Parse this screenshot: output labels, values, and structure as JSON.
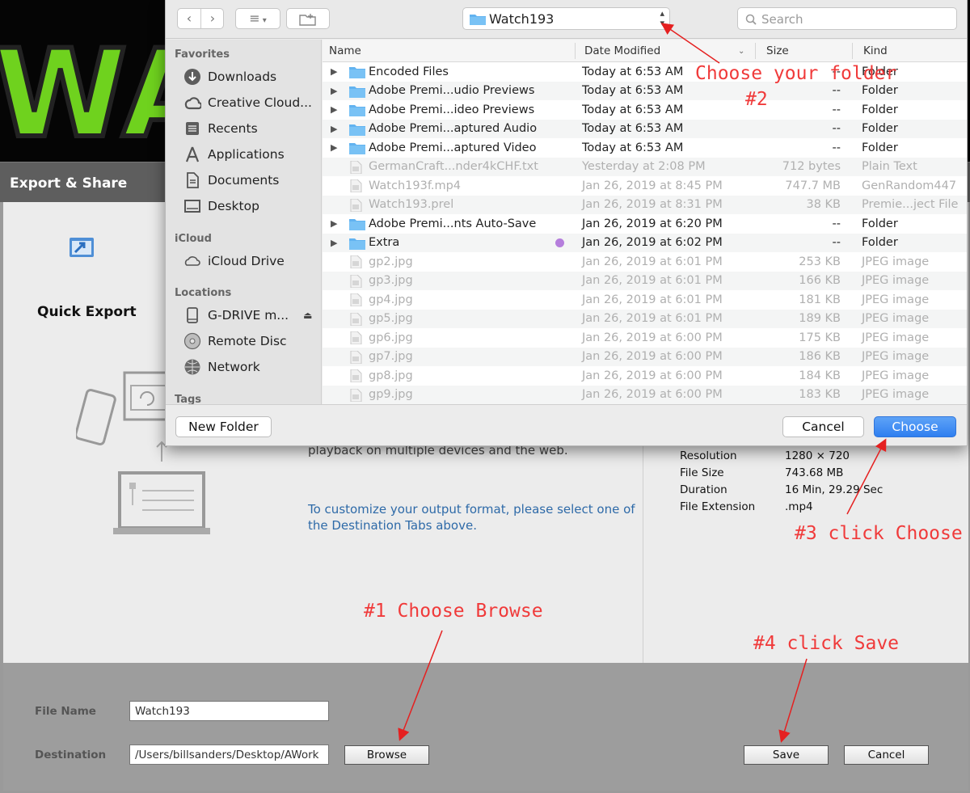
{
  "app": {
    "logo_text": "WA",
    "header_title": "Export & Share",
    "quick_export_label": "Quick Export",
    "description": "playback on multiple devices and the web.",
    "customize_text": "To customize your output format, please select one of the Destination Tabs above.",
    "info": [
      {
        "key": "Resolution",
        "value": "1280 × 720"
      },
      {
        "key": "File Size",
        "value": "743.68 MB"
      },
      {
        "key": "Duration",
        "value": "16 Min, 29.29 Sec"
      },
      {
        "key": "File Extension",
        "value": ".mp4"
      }
    ],
    "file_name_label": "File Name",
    "file_name_value": "Watch193",
    "destination_label": "Destination",
    "destination_value": "/Users/billsanders/Desktop/AWork",
    "browse_label": "Browse",
    "save_label": "Save",
    "cancel_label": "Cancel"
  },
  "dialog": {
    "current_folder": "Watch193",
    "search_placeholder": "Search",
    "sidebar": {
      "favorites_heading": "Favorites",
      "favorites": [
        {
          "label": "Downloads",
          "icon": "downloads-icon"
        },
        {
          "label": "Creative Cloud...",
          "icon": "creative-cloud-icon"
        },
        {
          "label": "Recents",
          "icon": "recents-icon"
        },
        {
          "label": "Applications",
          "icon": "applications-icon"
        },
        {
          "label": "Documents",
          "icon": "documents-icon"
        },
        {
          "label": "Desktop",
          "icon": "desktop-icon"
        }
      ],
      "icloud_heading": "iCloud",
      "icloud": [
        {
          "label": "iCloud Drive",
          "icon": "cloud-icon"
        }
      ],
      "locations_heading": "Locations",
      "locations": [
        {
          "label": "G-DRIVE m...",
          "icon": "drive-icon"
        },
        {
          "label": "Remote Disc",
          "icon": "disc-icon"
        },
        {
          "label": "Network",
          "icon": "globe-icon"
        }
      ],
      "tags_heading": "Tags"
    },
    "columns": {
      "name": "Name",
      "date": "Date Modified",
      "size": "Size",
      "kind": "Kind"
    },
    "files": [
      {
        "name": "Encoded Files",
        "date": "Today at 6:53 AM",
        "size": "--",
        "kind": "Folder",
        "folder": true
      },
      {
        "name": "Adobe Premi...udio Previews",
        "date": "Today at 6:53 AM",
        "size": "--",
        "kind": "Folder",
        "folder": true
      },
      {
        "name": "Adobe Premi...ideo Previews",
        "date": "Today at 6:53 AM",
        "size": "--",
        "kind": "Folder",
        "folder": true
      },
      {
        "name": "Adobe Premi...aptured Audio",
        "date": "Today at 6:53 AM",
        "size": "--",
        "kind": "Folder",
        "folder": true
      },
      {
        "name": "Adobe Premi...aptured Video",
        "date": "Today at 6:53 AM",
        "size": "--",
        "kind": "Folder",
        "folder": true
      },
      {
        "name": "GermanCraft...nder4kCHF.txt",
        "date": "Yesterday at 2:08 PM",
        "size": "712 bytes",
        "kind": "Plain Text",
        "folder": false
      },
      {
        "name": "Watch193f.mp4",
        "date": "Jan 26, 2019 at 8:45 PM",
        "size": "747.7 MB",
        "kind": "GenRandom447",
        "folder": false
      },
      {
        "name": "Watch193.prel",
        "date": "Jan 26, 2019 at 8:31 PM",
        "size": "38 KB",
        "kind": "Premie...ject File",
        "folder": false
      },
      {
        "name": "Adobe Premi...nts Auto-Save",
        "date": "Jan 26, 2019 at 6:20 PM",
        "size": "--",
        "kind": "Folder",
        "folder": true
      },
      {
        "name": "Extra",
        "date": "Jan 26, 2019 at 6:02 PM",
        "size": "--",
        "kind": "Folder",
        "folder": true
      },
      {
        "name": "gp2.jpg",
        "date": "Jan 26, 2019 at 6:01 PM",
        "size": "253 KB",
        "kind": "JPEG image",
        "folder": false
      },
      {
        "name": "gp3.jpg",
        "date": "Jan 26, 2019 at 6:01 PM",
        "size": "166 KB",
        "kind": "JPEG image",
        "folder": false
      },
      {
        "name": "gp4.jpg",
        "date": "Jan 26, 2019 at 6:01 PM",
        "size": "181 KB",
        "kind": "JPEG image",
        "folder": false
      },
      {
        "name": "gp5.jpg",
        "date": "Jan 26, 2019 at 6:01 PM",
        "size": "189 KB",
        "kind": "JPEG image",
        "folder": false
      },
      {
        "name": "gp6.jpg",
        "date": "Jan 26, 2019 at 6:00 PM",
        "size": "175 KB",
        "kind": "JPEG image",
        "folder": false
      },
      {
        "name": "gp7.jpg",
        "date": "Jan 26, 2019 at 6:00 PM",
        "size": "186 KB",
        "kind": "JPEG image",
        "folder": false
      },
      {
        "name": "gp8.jpg",
        "date": "Jan 26, 2019 at 6:00 PM",
        "size": "184 KB",
        "kind": "JPEG image",
        "folder": false
      },
      {
        "name": "gp9.jpg",
        "date": "Jan 26, 2019 at 6:00 PM",
        "size": "183 KB",
        "kind": "JPEG image",
        "folder": false
      }
    ],
    "new_folder_label": "New Folder",
    "cancel_label": "Cancel",
    "choose_label": "Choose"
  },
  "annotations": {
    "step2_line1": "Choose your folder",
    "step2_line2": "#2",
    "step1": "#1  Choose Browse",
    "step3": "#3 click Choose",
    "step4": "#4 click Save"
  },
  "colors": {
    "annotation": "#f03a3a",
    "accent": "#2f7ff0",
    "logo_green": "#6fd21e"
  }
}
